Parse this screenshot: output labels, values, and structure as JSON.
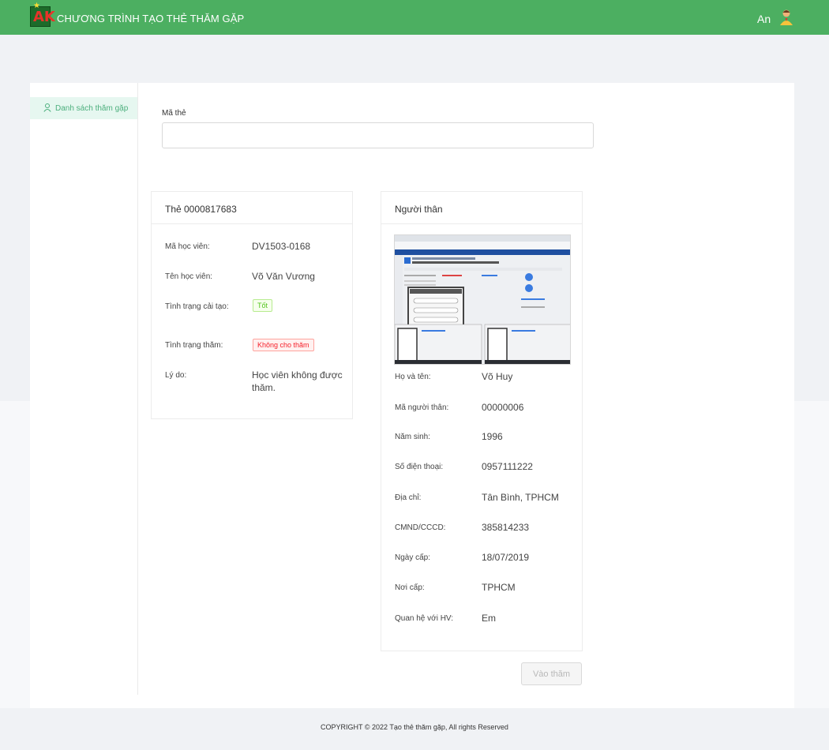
{
  "header": {
    "app_title": "CHƯƠNG TRÌNH TẠO THẺ THĂM GẶP",
    "logo_text": "AK",
    "user_name": "An"
  },
  "sidebar": {
    "items": [
      {
        "label": "Danh sách thăm gặp",
        "icon": "user-icon"
      }
    ]
  },
  "search": {
    "label": "Mã thẻ",
    "value": "",
    "placeholder": ""
  },
  "card_info": {
    "title": "Thẻ 0000817683",
    "rows": [
      {
        "key": "Mã học viên:",
        "value": "DV1503-0168"
      },
      {
        "key": "Tên học viên:",
        "value": "Võ Văn Vương"
      },
      {
        "key": "Tình trạng cải tạo:",
        "value": "Tốt"
      },
      {
        "key": "Tình trạng thăm:",
        "value": "Không cho thăm"
      },
      {
        "key": "Lý do:",
        "value": "Học viên không được thăm."
      }
    ]
  },
  "relative": {
    "title": "Người thân",
    "photo_alt": "ảnh người thân",
    "rows": [
      {
        "key": "Họ và tên:",
        "value": "Võ Huy"
      },
      {
        "key": "Mã người thân:",
        "value": "00000006"
      },
      {
        "key": "Năm sinh:",
        "value": "1996"
      },
      {
        "key": "Số điện thoại:",
        "value": "0957111222"
      },
      {
        "key": "Địa chỉ:",
        "value": "Tân Bình, TPHCM"
      },
      {
        "key": "CMND/CCCD:",
        "value": "385814233"
      },
      {
        "key": "Ngày cấp:",
        "value": "18/07/2019"
      },
      {
        "key": "Nơi cấp:",
        "value": "TPHCM"
      },
      {
        "key": "Quan hệ với HV:",
        "value": "Em"
      }
    ]
  },
  "actions": {
    "visit_label": "Vào thăm"
  },
  "footer": {
    "text": "COPYRIGHT © 2022 Tạo thẻ thăm gặp, All rights Reserved"
  },
  "colors": {
    "header": "#4caf61",
    "accent": "#4caf7d",
    "tag_good": "#52c41a",
    "tag_bad": "#f5222d"
  }
}
